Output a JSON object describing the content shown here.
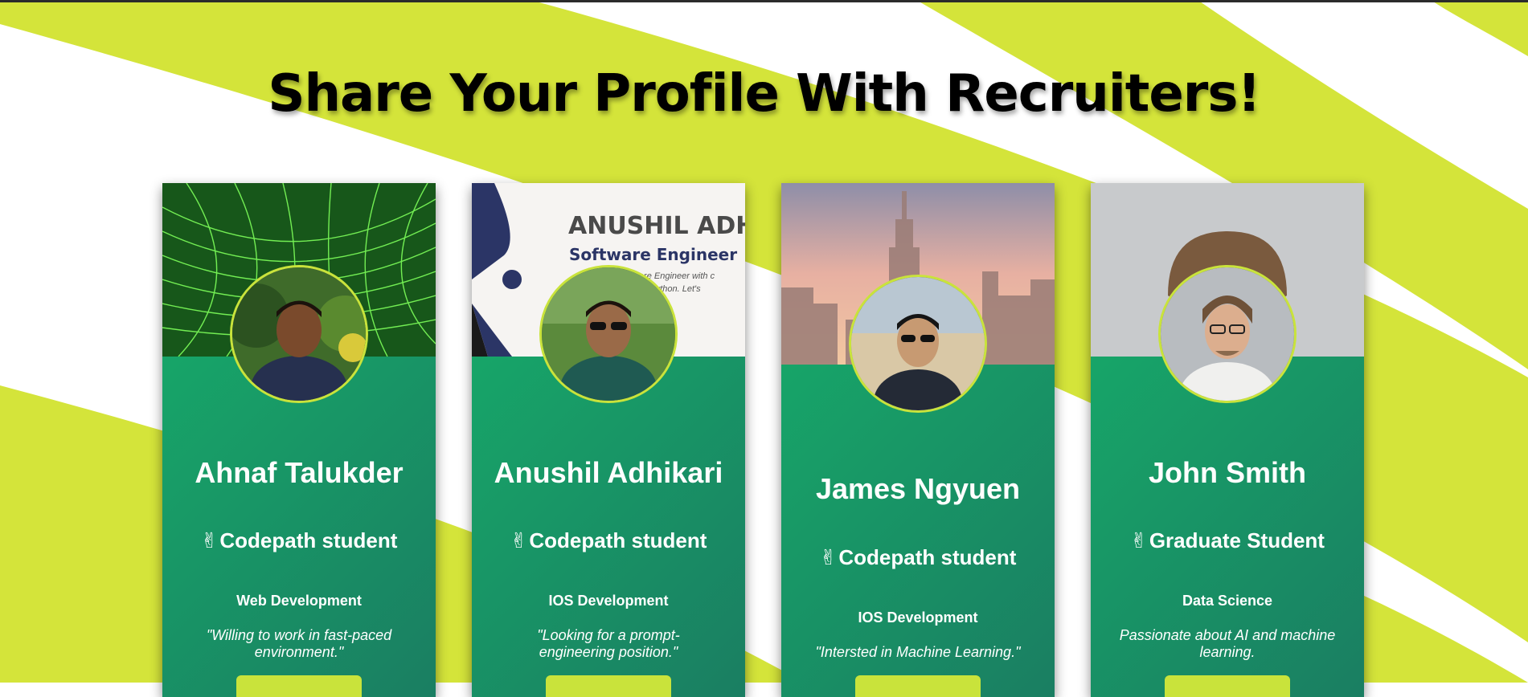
{
  "page": {
    "title": "Share Your Profile With Recruiters!",
    "colors": {
      "accent": "#c9e33b",
      "card_top": "#16b06a",
      "card_bottom": "#1a7e62"
    }
  },
  "cards": [
    {
      "name": "Ahnaf Talukder",
      "tag_icon": "✌",
      "tag": "Codepath student",
      "field": "Web Development",
      "quote": "\"Willing to work in fast-paced environment.\"",
      "cover": "green-grid-tunnel"
    },
    {
      "name": "Anushil Adhikari",
      "tag_icon": "✌",
      "tag": "Codepath student",
      "field": "IOS Development",
      "quote": "\"Looking for a prompt-engineering position.\"",
      "cover": "resume-banner",
      "cover_text": {
        "heading": "ANUSHIL ADHI",
        "subheading": "Software Engineer",
        "line1": "ware Engineer with c",
        "line2": "and Python. Let's"
      }
    },
    {
      "name": "James Ngyuen",
      "tag_icon": "✌",
      "tag": "Codepath student",
      "field": "IOS Development",
      "quote": "\"Intersted in Machine Learning.\"",
      "cover": "city-skyline"
    },
    {
      "name": "John Smith",
      "tag_icon": "✌",
      "tag": "Graduate Student",
      "field": "Data Science",
      "quote": "Passionate about AI and machine learning.",
      "cover": "grey-portrait"
    }
  ]
}
